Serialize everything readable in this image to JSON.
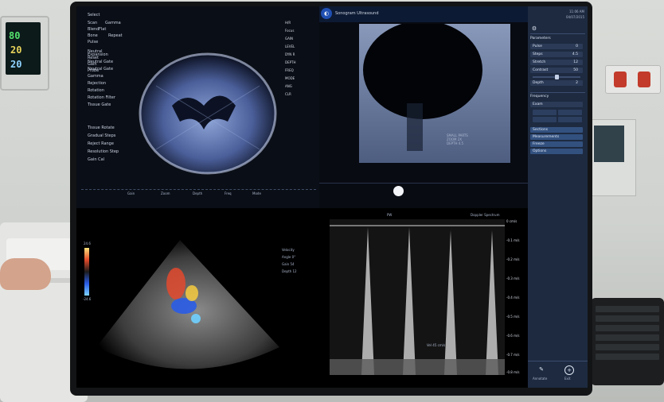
{
  "vitals": {
    "hr": "80",
    "spo2": "20",
    "resp": "20"
  },
  "header": {
    "app_title": "Sonogram Ultrasound",
    "subtitle": "",
    "time": "11:06 AM",
    "date": "04/07/2015"
  },
  "panel_tl": {
    "menu": [
      "Select",
      "Scan",
      "Blend",
      "Bone",
      "Pulse",
      "Neutral",
      "Reset",
      "Gain",
      "Probe"
    ],
    "menu_right": [
      "Gamma",
      "Flat",
      "Repeat"
    ],
    "settings": [
      "Expansion",
      "Neutral Gate",
      "Neutral Gate",
      "Gamma",
      "Rejection",
      "Rotation",
      "Rotation Filter",
      "Tissue Gate",
      "Tissue Gate",
      "ECG"
    ],
    "bottom_list": [
      "Tissue Rotate",
      "Gradual Steps",
      "Reject Range",
      "Resolution Step",
      "Gain Cal"
    ],
    "scale": [
      "H/R",
      "Focus",
      "GAIN",
      "LEVEL",
      "DYN R",
      "DEPTH",
      "FREQ",
      "MODE",
      "ANG",
      "CLR"
    ],
    "bottom_bar": [
      "Gain",
      "Zoom",
      "Depth",
      "Freq",
      "Mode",
      "Width"
    ]
  },
  "panel_tr": {
    "labels": [
      "SMALL PARTS",
      "ZOOM 2X",
      "DEPTH 4.5"
    ]
  },
  "panel_bl": {
    "colorbar_top": "24.6",
    "colorbar_bottom": "-24.6",
    "labels": [
      "Velocity",
      "Angle 0°",
      "Gain 54",
      "Depth 12"
    ]
  },
  "panel_br": {
    "header": [
      "PW",
      "Doppler Spectrum"
    ],
    "scale": [
      "0 cm/s",
      "-0.1 m/s",
      "-0.2 m/s",
      "-0.3 m/s",
      "-0.4 m/s",
      "-0.5 m/s",
      "-0.6 m/s",
      "-0.7 m/s",
      "-0.8 m/s"
    ],
    "readout": "Vel 45 cm/s"
  },
  "sidepanel": {
    "title": "",
    "section1": "Parameters",
    "rows1": [
      {
        "label": "Pulse",
        "value": "0"
      },
      {
        "label": "Steps",
        "value": "4.5"
      },
      {
        "label": "Stretch",
        "value": "12"
      },
      {
        "label": "Contrast",
        "value": "50"
      },
      {
        "label": "Depth",
        "value": "2"
      }
    ],
    "section2": "Frequency",
    "rows2": [
      {
        "label": "Exam",
        "value": ""
      }
    ],
    "buttons": [
      "Sections",
      "Measurements",
      "Freeze",
      "Options"
    ],
    "bottom_labels": [
      "Annotate",
      "Exit"
    ]
  },
  "colors": {
    "background": "#05070a",
    "accent": "#2f6fd6",
    "sidepanel": "#1d2a40"
  }
}
